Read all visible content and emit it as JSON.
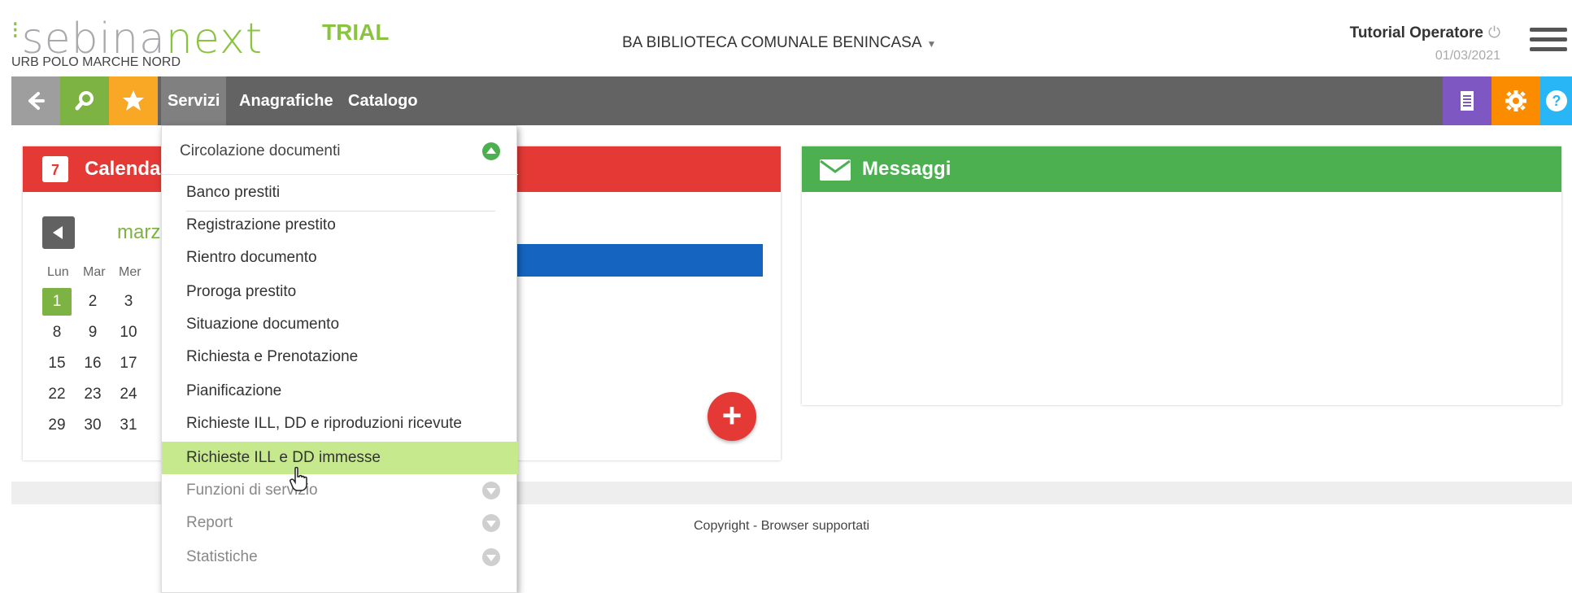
{
  "header": {
    "logo_part1": "sebina",
    "logo_part2": "next",
    "logo_dots": "⁝",
    "sublogo": "URB POLO MARCHE NORD",
    "trial": "TRIAL",
    "library": "BA BIBLIOTECA COMUNALE BENINCASA",
    "user": "Tutorial Operatore",
    "date": "01/03/2021"
  },
  "nav": {
    "links": [
      "Servizi",
      "Anagrafiche",
      "Catalogo"
    ],
    "icons": [
      "back-arrow-icon",
      "search-icon",
      "star-icon",
      "document-icon",
      "gear-icon",
      "help-icon"
    ],
    "colors": {
      "bar": "#636363",
      "back": "#9e9e9e",
      "search": "#7cb342",
      "star": "#f9a825",
      "doc": "#7e57c2",
      "gear": "#fb8c00",
      "help": "#29b6f6"
    }
  },
  "calendar": {
    "title": "Calendar",
    "month": "marz",
    "weekdays": [
      "Lun",
      "Mar",
      "Mer"
    ],
    "weeks": [
      [
        "1",
        "2",
        "3"
      ],
      [
        "8",
        "9",
        "10"
      ],
      [
        "15",
        "16",
        "17"
      ],
      [
        "22",
        "23",
        "24"
      ],
      [
        "29",
        "30",
        "31"
      ]
    ],
    "today": "1",
    "calendar_icon_label": "7"
  },
  "messages": {
    "title": "Messaggi"
  },
  "footer": {
    "copyright": "Copyright - Browser supportati"
  },
  "dropdown": {
    "section": "Circolazione documenti",
    "items": [
      "Banco prestiti",
      "Registrazione prestito",
      "Rientro documento",
      "Proroga prestito",
      "Situazione documento",
      "Richiesta e Prenotazione",
      "Pianificazione",
      "Richieste ILL, DD e riproduzioni ricevute",
      "Richieste ILL e DD immesse"
    ],
    "highlighted": "Richieste ILL e DD immesse",
    "collapsed_sections": [
      "Funzioni di servizio",
      "Report",
      "Statistiche"
    ]
  }
}
